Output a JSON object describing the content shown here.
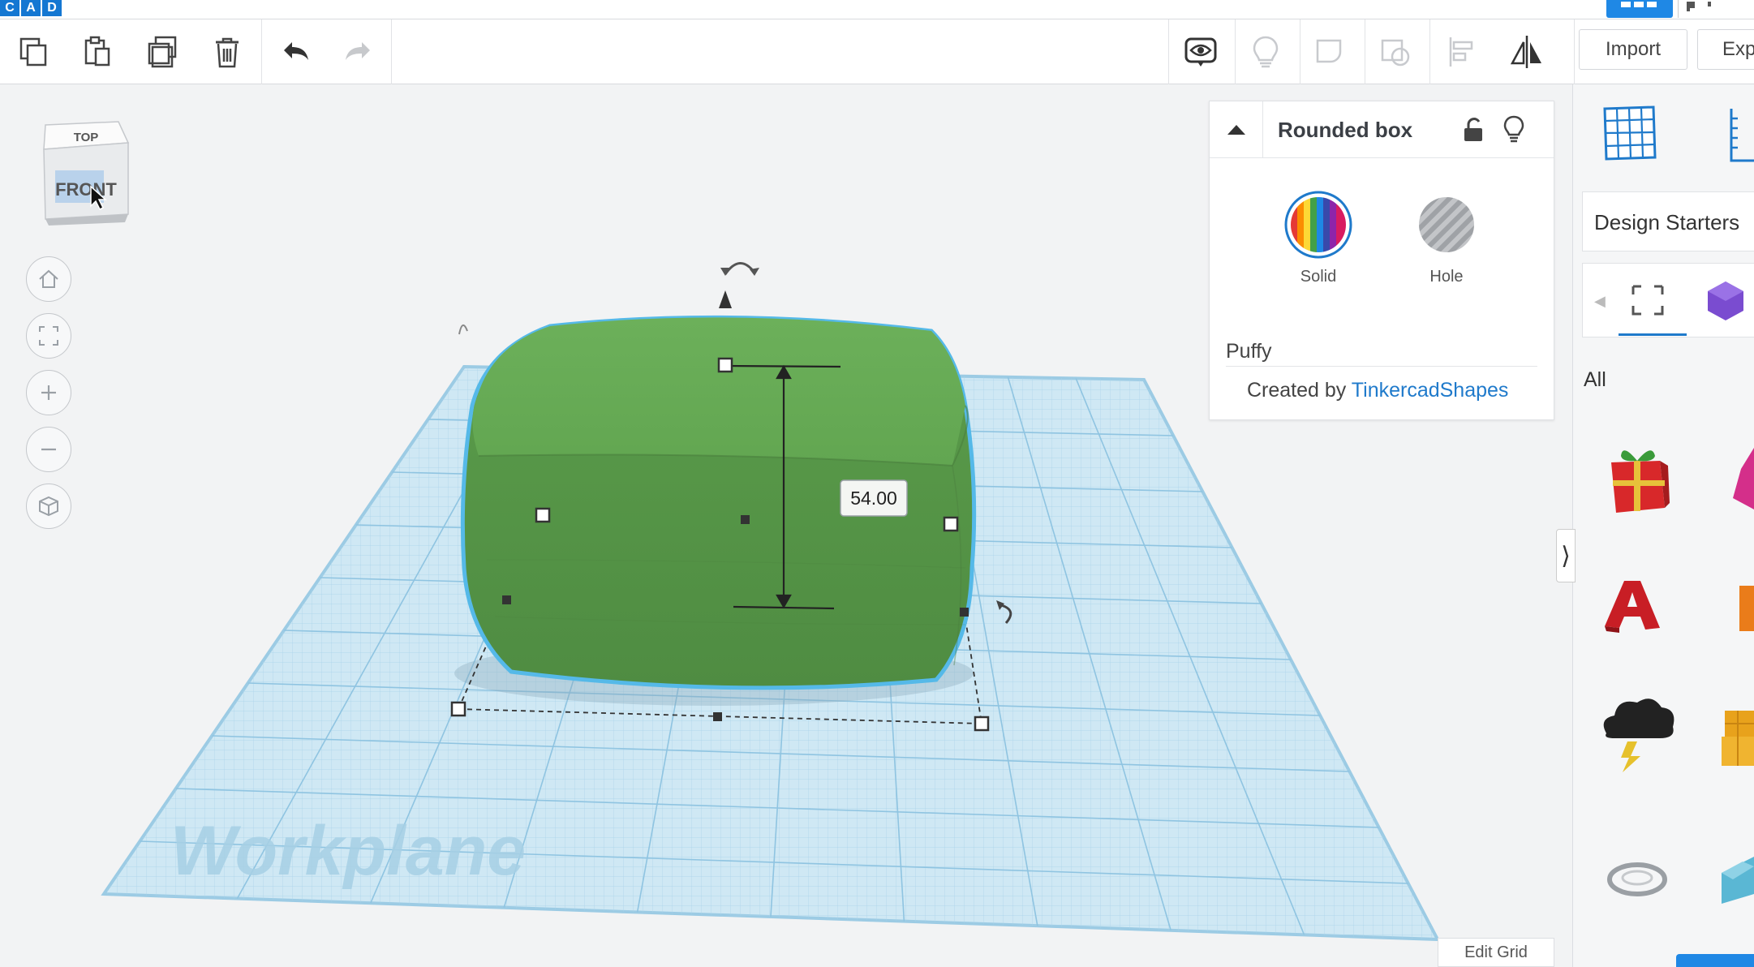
{
  "app": {
    "logo_letters": [
      "C",
      "A",
      "D"
    ]
  },
  "toolbar": {
    "import_label": "Import",
    "export_label": "Exp",
    "icons": [
      "copy-icon",
      "paste-icon",
      "duplicate-icon",
      "trash-icon",
      "undo-icon",
      "redo-icon",
      "show-all-icon",
      "hide-icon",
      "group-icon",
      "ungroup-icon",
      "align-icon",
      "mirror-icon"
    ]
  },
  "viewcube": {
    "top_label": "TOP",
    "front_label": "FRONT"
  },
  "workplane": {
    "label": "Workplane",
    "dimension_value": "54.00",
    "shape_color": "#5fa64f",
    "grid_color": "#bfe0ef"
  },
  "inspector": {
    "title": "Rounded box",
    "solid_label": "Solid",
    "hole_label": "Hole",
    "shape_name": "Puffy",
    "created_by_prefix": "Created by",
    "creator": "TinkercadShapes"
  },
  "right_panel": {
    "design_starters_label": "Design Starters",
    "all_label": "All"
  },
  "footer": {
    "edit_grid_label": "Edit Grid"
  }
}
